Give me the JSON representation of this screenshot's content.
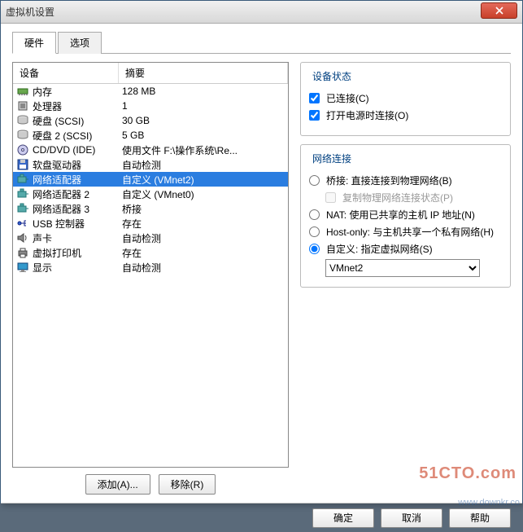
{
  "title": "虚拟机设置",
  "tabs": [
    "硬件",
    "选项"
  ],
  "active_tab": 0,
  "list_headers": [
    "设备",
    "摘要"
  ],
  "devices": [
    {
      "icon": "memory",
      "label": "内存",
      "summary": "128 MB"
    },
    {
      "icon": "cpu",
      "label": "处理器",
      "summary": "1"
    },
    {
      "icon": "disk",
      "label": "硬盘 (SCSI)",
      "summary": "30 GB"
    },
    {
      "icon": "disk",
      "label": "硬盘 2 (SCSI)",
      "summary": "5 GB"
    },
    {
      "icon": "cd",
      "label": "CD/DVD (IDE)",
      "summary": "使用文件 F:\\操作系统\\Re..."
    },
    {
      "icon": "floppy",
      "label": "软盘驱动器",
      "summary": "自动检测"
    },
    {
      "icon": "net",
      "label": "网络适配器",
      "summary": "自定义 (VMnet2)",
      "selected": true
    },
    {
      "icon": "net",
      "label": "网络适配器 2",
      "summary": "自定义 (VMnet0)"
    },
    {
      "icon": "net",
      "label": "网络适配器 3",
      "summary": "桥接"
    },
    {
      "icon": "usb",
      "label": "USB 控制器",
      "summary": "存在"
    },
    {
      "icon": "sound",
      "label": "声卡",
      "summary": "自动检测"
    },
    {
      "icon": "printer",
      "label": "虚拟打印机",
      "summary": "存在"
    },
    {
      "icon": "display",
      "label": "显示",
      "summary": "自动检测"
    }
  ],
  "buttons": {
    "add": "添加(A)...",
    "remove": "移除(R)"
  },
  "status": {
    "legend": "设备状态",
    "connected": "已连接(C)",
    "connect_on_power": "打开电源时连接(O)"
  },
  "netconn": {
    "legend": "网络连接",
    "bridged": "桥接: 直接连接到物理网络(B)",
    "replicate": "复制物理网络连接状态(P)",
    "nat": "NAT: 使用已共享的主机 IP 地址(N)",
    "hostonly": "Host-only: 与主机共享一个私有网络(H)",
    "custom": "自定义: 指定虚拟网络(S)",
    "selected": "custom",
    "vnet": "VMnet2"
  },
  "dialog_buttons": {
    "ok": "确定",
    "cancel": "取消",
    "help": "帮助"
  },
  "watermarks": {
    "a": "51CTO.com",
    "b": "www.downkr.co"
  }
}
